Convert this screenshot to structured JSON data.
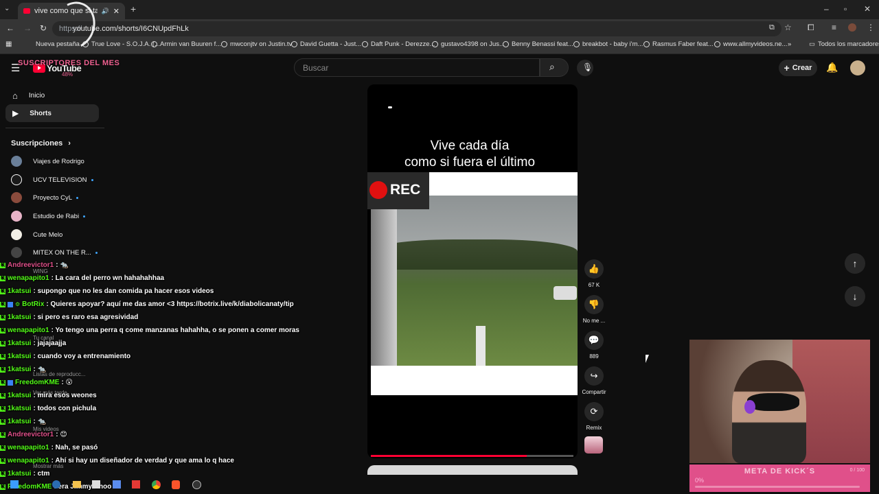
{
  "browser": {
    "tab_title": "vive como que si tal fuera la...",
    "url": "youtube.com/shorts/I6CNUpdFhLk",
    "url_prefix": "https://",
    "bookmarks": [
      "Nueva pestaña",
      "True Love - S.O.J.A. (...",
      "Armin van Buuren f...",
      "mwconjtv on Justin.tv",
      "David Guetta - Just...",
      "Daft Punk - Derezze...",
      "gustavo4398 on Jus...",
      "Benny Benassi feat...",
      "breakbot - baby i'm...",
      "Rasmus Faber feat...",
      "www.allmyvideos.ne..."
    ],
    "all_bookmarks": "Todos los marcadores"
  },
  "youtube": {
    "logo_text": "YouTube",
    "search_placeholder": "Buscar",
    "create_label": "Crear",
    "sidebar": {
      "home": "Inicio",
      "shorts": "Shorts",
      "subscriptions": "Suscripciones",
      "channels": [
        {
          "name": "Viajes de Rodrigo",
          "color": "#6a7f99",
          "dot": false
        },
        {
          "name": "UCV TELEVISION",
          "color": "#1a1a1a",
          "dot": true
        },
        {
          "name": "Proyecto CyL",
          "color": "#8a4b3c",
          "dot": true
        },
        {
          "name": "Estudio de Rabi",
          "color": "#e8b4c8",
          "dot": true
        },
        {
          "name": "Cute Melo",
          "color": "#f2efe6",
          "dot": false
        },
        {
          "name": "MITEX ON THE R...",
          "color": "#444444",
          "dot": true
        }
      ],
      "ghost_items": [
        "WING",
        "Tu canal",
        "Listas de reproducc...",
        "Ver más tarde",
        "Mis videos",
        "Mostrar más"
      ]
    },
    "short": {
      "caption_line1": "Vive cada día",
      "caption_line2": "como si fuera el último",
      "rec_label": "REC",
      "progress": 0.77
    },
    "actions": {
      "likes": "67 K",
      "dislike": "No me ...",
      "comments": "889",
      "share": "Compartir",
      "remix": "Remix"
    }
  },
  "stream_overlay": {
    "subs_title": "SUSCRIPTORES DEL MES",
    "subs_percent": "48%",
    "goal_title": "META DE KICK´S",
    "goal_percent": "0%",
    "goal_count": "0 / 100",
    "goal_progress": 0
  },
  "chat": [
    {
      "user": "Andreevictor1",
      "msg": ": 🐀"
    },
    {
      "user": "wenapapito1",
      "msg": ": La cara del perro wn hahahahhaa"
    },
    {
      "user": "1katsui",
      "msg": ": supongo que no les dan comida pa hacer esos videos"
    },
    {
      "user": "BotRix",
      "msg": ": Quieres apoyar? aquí me das amor <3 https://botrix.live/k/diabolicanaty/tip"
    },
    {
      "user": "1katsui",
      "msg": ": si pero es raro esa agresividad"
    },
    {
      "user": "wenapapito1",
      "msg": ": Yo tengo una perra q come manzanas hahahha, o se ponen a comer moras"
    },
    {
      "user": "1katsui",
      "msg": ": jajajaajja"
    },
    {
      "user": "1katsui",
      "msg": ": cuando voy a entrenamiento"
    },
    {
      "user": "1katsui",
      "msg": ": 🐀"
    },
    {
      "user": "FreedomKME",
      "msg": ": 😮"
    },
    {
      "user": "1katsui",
      "msg": ": mira esos weones"
    },
    {
      "user": "1katsui",
      "msg": ": todos con pichula"
    },
    {
      "user": "1katsui",
      "msg": ": 🐀"
    },
    {
      "user": "Andreevictor1",
      "msg": ": 😊"
    },
    {
      "user": "wenapapito1",
      "msg": ": Nah, se pasó"
    },
    {
      "user": "wenapapito1",
      "msg": ": Ahí si hay un diseñador de verdad y que ama lo q hace"
    },
    {
      "user": "1katsui",
      "msg": ": ctm"
    },
    {
      "user": "FreedomKME",
      "msg": ": era Jimmy Choo"
    }
  ],
  "colors": {
    "kick_green": "#53fc18",
    "yt_red": "#ff0033",
    "overlay_pink": "#e0508a"
  }
}
